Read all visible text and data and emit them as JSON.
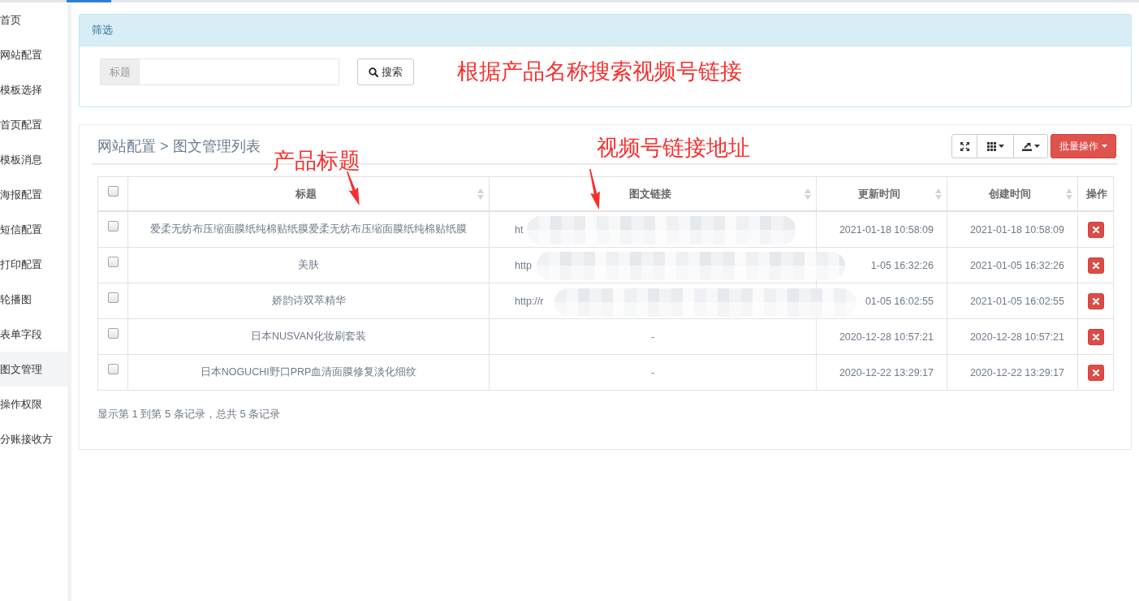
{
  "sidebar": {
    "items": [
      {
        "label": "首页",
        "selected": false
      },
      {
        "label": "网站配置",
        "selected": false
      },
      {
        "label": "模板选择",
        "selected": false
      },
      {
        "label": "首页配置",
        "selected": false
      },
      {
        "label": "模板消息",
        "selected": false
      },
      {
        "label": "海报配置",
        "selected": false
      },
      {
        "label": "短信配置",
        "selected": false
      },
      {
        "label": "打印配置",
        "selected": false
      },
      {
        "label": "轮播图",
        "selected": false
      },
      {
        "label": "表单字段",
        "selected": false
      },
      {
        "label": "图文管理",
        "selected": true
      },
      {
        "label": "操作权限",
        "selected": false
      },
      {
        "label": "分账接收方",
        "selected": false
      }
    ]
  },
  "filter_panel": {
    "title": "筛选",
    "field": {
      "label": "标题"
    },
    "search_button": "搜索",
    "annotation": "根据产品名称搜索视频号链接"
  },
  "list_panel": {
    "breadcrumb": "网站配置 > 图文管理列表",
    "toolbar": {
      "icon_buttons": [
        {
          "kind": "fullscreen",
          "dropdown": false
        },
        {
          "kind": "columns",
          "dropdown": true
        },
        {
          "kind": "export",
          "dropdown": true
        }
      ],
      "batch_button": "批量操作"
    },
    "annotations": [
      "产品标题",
      "视频号链接地址"
    ],
    "table": {
      "select_all": {
        "checked": false
      },
      "columns": [
        {
          "label": "标题",
          "sortable": true
        },
        {
          "label": "图文链接",
          "sortable": true
        },
        {
          "label": "更新时间",
          "sortable": true
        },
        {
          "label": "创建时间",
          "sortable": true
        },
        {
          "label": "操作",
          "sortable": false
        }
      ],
      "rows": [
        {
          "checked": false,
          "title": "爱柔无纺布压缩面膜纸纯棉贴纸膜爱柔无纺布压缩面膜纸纯棉贴纸膜",
          "link": "ht",
          "redacted": true,
          "updated": "2021-01-18 10:58:09",
          "created": "2021-01-18 10:58:09",
          "deletable": true
        },
        {
          "checked": false,
          "title": "美肤",
          "link": "http",
          "redacted": true,
          "updated": "1-05 16:32:26",
          "created": "2021-01-05 16:32:26",
          "deletable": true
        },
        {
          "checked": false,
          "title": "娇韵诗双萃精华",
          "link": "http://r",
          "redacted": true,
          "updated": "01-05 16:02:55",
          "created": "2021-01-05 16:02:55",
          "deletable": true
        },
        {
          "checked": false,
          "title": "日本NUSVAN化妆刷套装",
          "link": "-",
          "redacted": false,
          "updated": "2020-12-28 10:57:21",
          "created": "2020-12-28 10:57:21",
          "deletable": true
        },
        {
          "checked": false,
          "title": "日本NOGUCHI野口PRP血清面膜修复淡化细纹",
          "link": "-",
          "redacted": false,
          "updated": "2020-12-22 13:29:17",
          "created": "2020-12-22 13:29:17",
          "deletable": true
        }
      ]
    },
    "footer": "显示第 1 到第 5 条记录，总共 5 条记录"
  }
}
